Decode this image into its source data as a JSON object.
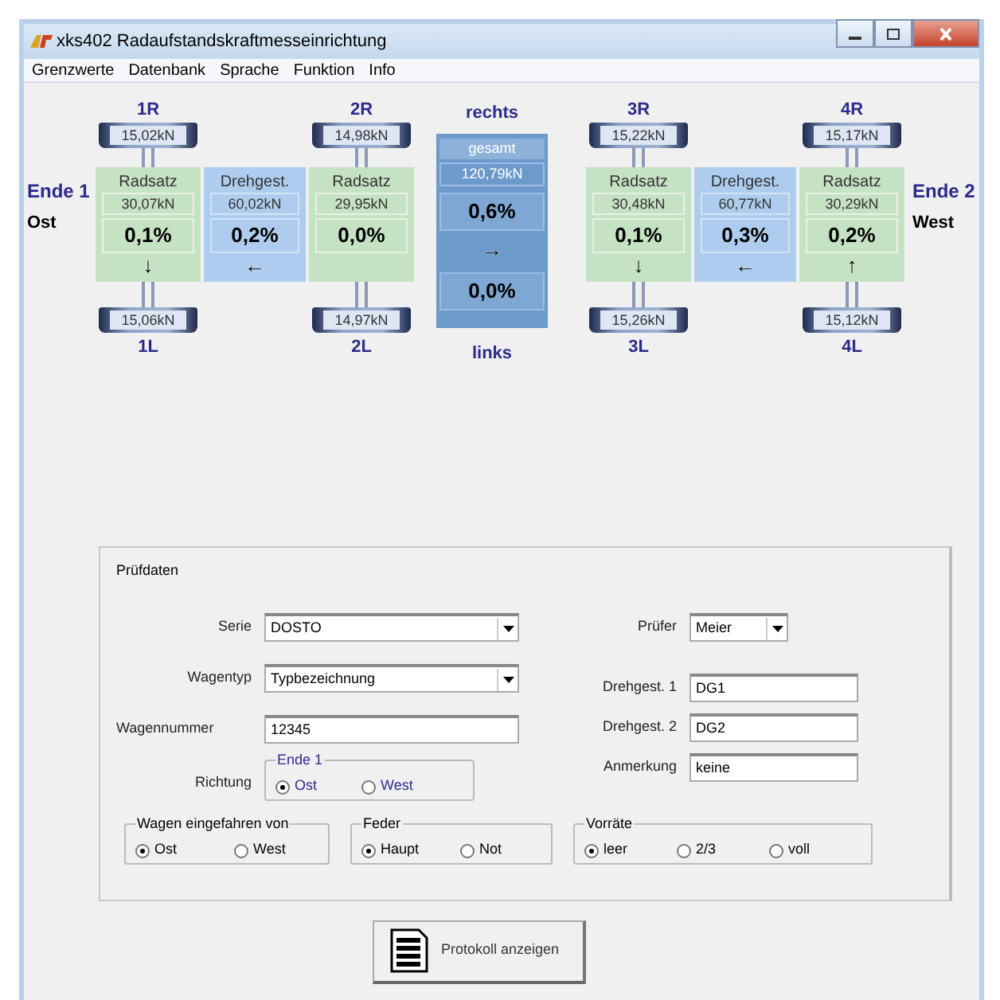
{
  "window": {
    "title": "xks402 Radaufstandskraftmesseinrichtung"
  },
  "menu": [
    "Grenzwerte",
    "Datenbank",
    "Sprache",
    "Funktion",
    "Info"
  ],
  "ends": [
    {
      "label": "Ende 1",
      "direction": "Ost"
    },
    {
      "label": "Ende 2",
      "direction": "West"
    }
  ],
  "bogies": [
    {
      "axles": [
        {
          "top_label": "1R",
          "top_value": "15,02kN",
          "name": "Radsatz",
          "force": "30,07kN",
          "percent": "0,1%",
          "arrow": "↓",
          "bottom_value": "15,06kN",
          "bottom_label": "1L"
        },
        {
          "top_label": "2R",
          "top_value": "14,98kN",
          "name": "Radsatz",
          "force": "29,95kN",
          "percent": "0,0%",
          "bottom_value": "14,97kN",
          "bottom_label": "2L"
        }
      ],
      "bogie": {
        "name": "Drehgest.",
        "force": "60,02kN",
        "percent": "0,2%",
        "arrow": "←"
      }
    },
    {
      "axles": [
        {
          "top_label": "3R",
          "top_value": "15,22kN",
          "name": "Radsatz",
          "force": "30,48kN",
          "percent": "0,1%",
          "arrow": "↓",
          "bottom_value": "15,26kN",
          "bottom_label": "3L"
        },
        {
          "top_label": "4R",
          "top_value": "15,17kN",
          "name": "Radsatz",
          "force": "30,29kN",
          "percent": "0,2%",
          "arrow": "↑",
          "bottom_value": "15,12kN",
          "bottom_label": "4L"
        }
      ],
      "bogie": {
        "name": "Drehgest.",
        "force": "60,77kN",
        "percent": "0,3%",
        "arrow": "←"
      }
    }
  ],
  "total": {
    "top_label": "rechts",
    "name": "gesamt",
    "force": "120,79kN",
    "percent": "0,6%",
    "arrow": "→",
    "percent_2": "0,0%",
    "bottom_label": "links"
  },
  "test_data": {
    "title": "Prüfdaten",
    "left_fields": [
      {
        "label": "Serie",
        "kind": "select",
        "value": "DOSTO"
      },
      {
        "label": "Wagentyp",
        "kind": "select",
        "value": "Typbezeichnung"
      },
      {
        "label": "Wagennummer",
        "kind": "text",
        "value": "12345"
      }
    ],
    "direction": {
      "label": "Richtung",
      "legend": "Ende 1",
      "options": [
        {
          "label": "Ost",
          "selected": true
        },
        {
          "label": "West",
          "selected": false
        }
      ]
    },
    "right_fields": [
      {
        "label": "Prüfer",
        "kind": "select",
        "value": "Meier"
      },
      {
        "label": "Drehgest. 1",
        "kind": "text",
        "value": "DG1"
      },
      {
        "label": "Drehgest. 2",
        "kind": "text",
        "value": "DG2"
      },
      {
        "label": "Anmerkung",
        "kind": "text",
        "value": "keine"
      }
    ],
    "groups": [
      {
        "legend": "Wagen eingefahren von",
        "options": [
          {
            "label": "Ost",
            "selected": true
          },
          {
            "label": "West",
            "selected": false
          }
        ]
      },
      {
        "legend": "Feder",
        "options": [
          {
            "label": "Haupt",
            "selected": true
          },
          {
            "label": "Not",
            "selected": false
          }
        ]
      },
      {
        "legend": "Vorräte",
        "options": [
          {
            "label": "leer",
            "selected": true
          },
          {
            "label": "2/3",
            "selected": false
          },
          {
            "label": "voll",
            "selected": false
          }
        ]
      }
    ]
  },
  "button": {
    "label": "Protokoll anzeigen"
  }
}
